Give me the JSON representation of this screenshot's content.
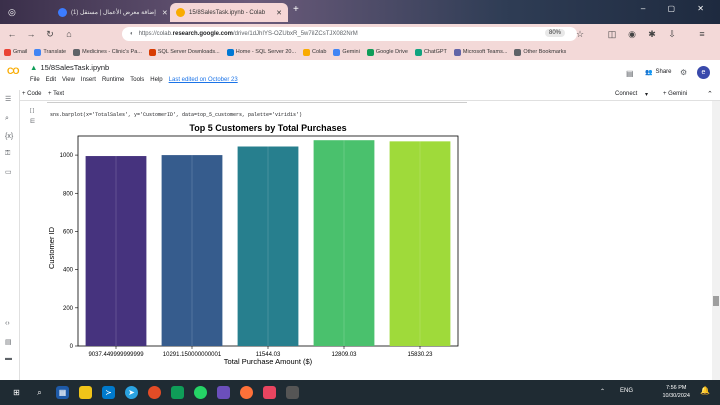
{
  "browser": {
    "tabs": [
      {
        "label": "(1) إضافة معرض الأعمال | مستقل",
        "active": false,
        "color": "#3c7cff"
      },
      {
        "label": "15/8SalesTask.ipynb - Colab",
        "active": true,
        "color": "#f9ab00"
      }
    ],
    "new_tab": "+",
    "url_prefix": "https://colab.",
    "url_domain": "research.google.com",
    "url_suffix": "/drive/1dJhIYS-OZUbxR_5w7iIZCsTJX082NrM",
    "zoom": "80%"
  },
  "bookmarks": [
    {
      "label": "Gmail",
      "color": "#ea4335"
    },
    {
      "label": "Translate",
      "color": "#4285f4"
    },
    {
      "label": "Medicines - Clinic's Pa...",
      "color": "#5f6368"
    },
    {
      "label": "SQL Server Downloads...",
      "color": "#d83b01"
    },
    {
      "label": "Home - SQL Server 20...",
      "color": "#0078d4"
    },
    {
      "label": "Colab",
      "color": "#f9ab00"
    },
    {
      "label": "Gemini",
      "color": "#4285f4"
    },
    {
      "label": "Google Drive",
      "color": "#0f9d58"
    },
    {
      "label": "ChatGPT",
      "color": "#10a37f"
    },
    {
      "label": "Microsoft Teams...",
      "color": "#6264a7"
    },
    {
      "label": "Other Bookmarks",
      "color": "#5f6368"
    }
  ],
  "colab": {
    "logo": "CO",
    "notebook_name": "15/8SalesTask.ipynb",
    "menu": [
      "File",
      "Edit",
      "View",
      "Insert",
      "Runtime",
      "Tools",
      "Help"
    ],
    "last_edited": "Last edited on October 23",
    "share": "Share",
    "avatar": "e",
    "add_code": "+ Code",
    "add_text": "+ Text",
    "connect": "Connect",
    "gemini": "Gemini"
  },
  "cell": {
    "bracket": "[ ]",
    "code": "sns.barplot(x='TotalSales', y='CustomerID', data=top_5_customers, palette='viridis')"
  },
  "chart_data": {
    "type": "bar",
    "title": "Top 5 Customers by Total Purchases",
    "xlabel": "Total Purchase Amount ($)",
    "ylabel": "Customer ID",
    "categories": [
      "9037.449999999999",
      "10291.150000000001",
      "11544.03",
      "12809.03",
      "15830.23"
    ],
    "values": [
      995,
      1000,
      1045,
      1078,
      1072
    ],
    "ylim": [
      0,
      1100
    ],
    "yticks": [
      0,
      200,
      400,
      600,
      800,
      1000
    ],
    "colors": [
      "#46337e",
      "#365c8d",
      "#277f8e",
      "#4ac16d",
      "#9fda3a"
    ]
  },
  "taskbar": {
    "time": "7:56 PM",
    "date": "10/30/2024",
    "lang": "ENG"
  }
}
